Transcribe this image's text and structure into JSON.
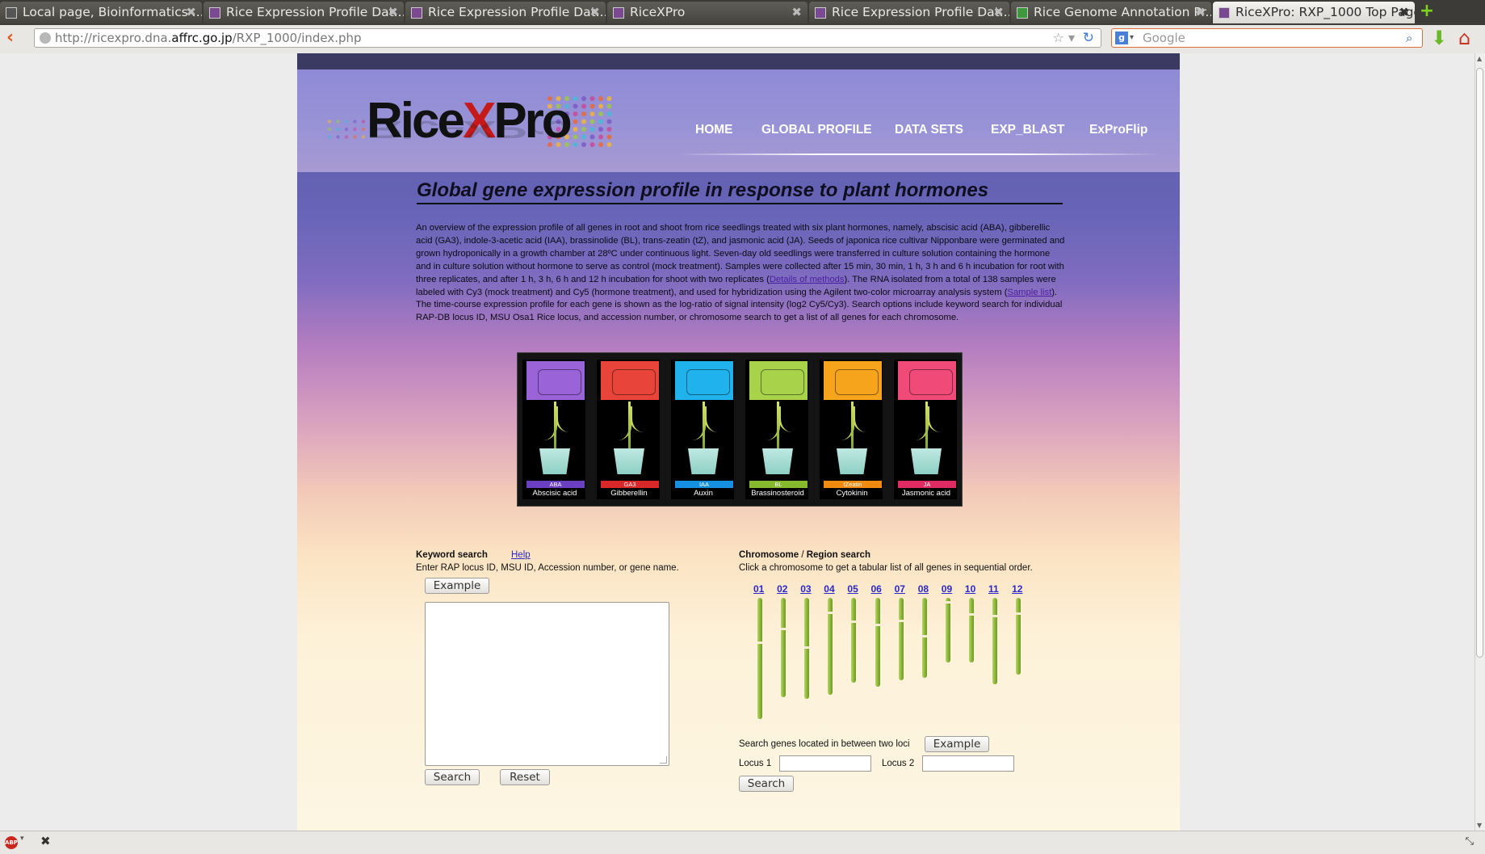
{
  "browser": {
    "tabs": [
      {
        "title": "Local page, Bioinformatics ...",
        "active": false
      },
      {
        "title": "Rice Expression Profile Dat...",
        "active": false
      },
      {
        "title": "Rice Expression Profile Dat...",
        "active": false
      },
      {
        "title": "RiceXPro",
        "active": false
      },
      {
        "title": "Rice Expression Profile Dat...",
        "active": false
      },
      {
        "title": "Rice Genome Annotation Pr...",
        "active": false
      },
      {
        "title": "RiceXPro: RXP_1000 Top Page",
        "active": true
      }
    ],
    "url_prefix": "http://ricexpro.dna.",
    "url_domain": "affrc.go.jp",
    "url_path": "/RXP_1000/index.php",
    "search_placeholder": "Google",
    "search_engine_icon": "g-icon",
    "close_glyph": "✖"
  },
  "site": {
    "logo_part1": "Rice",
    "logo_x": "X",
    "logo_part2": "Pro",
    "nav": [
      "HOME",
      "GLOBAL PROFILE",
      "DATA SETS",
      "EXP_BLAST",
      "ExProFlip"
    ],
    "colors": {
      "logo_accent": "#c61a1a",
      "link": "#2a28c8",
      "chromosome": "#8eb83a"
    }
  },
  "content": {
    "title": "Global gene expression profile in response to plant hormones",
    "intro_part1": "An overview of the expression profile of all genes in root and shoot from rice seedlings treated with six plant hormones, namely, abscisic acid (ABA), gibberellic acid (GA3), indole-3-acetic acid (IAA), brassinolide (BL), trans-zeatin (tZ), and jasmonic acid (JA). Seeds of japonica rice cultivar Nipponbare were germinated and grown hydroponically in a growth chamber at 28ºC under continuous light. Seven-day old seedlings were transferred in culture solution containing the hormone and in culture solution without hormone to serve as control (mock treatment). Samples were collected after 15 min, 30 min, 1 h, 3 h and 6 h incubation for root with three replicates, and after 1 h, 3 h, 6 h and 12 h incubation for shoot with two replicates (",
    "intro_link1": "Details of methods",
    "intro_part2": "). The RNA isolated from a total of 138 samples were labeled with Cy3 (mock treatment) and Cy5 (hormone treatment), and used for hybridization using the Agilent two-color microarray analysis system (",
    "intro_link2": "Sample list",
    "intro_part3": "). The time-course expression profile for each gene is shown as the log-ratio of signal intensity (log2 Cy5/Cy3). Search options include keyword search for individual RAP-DB locus ID, MSU Osa1 Rice locus, and accession number, or chromosome search to get a list of all genes for each chromosome."
  },
  "hormones": [
    {
      "abbr": "ABA",
      "name": "Abscisic acid",
      "color": "#9a63d8",
      "bar": "#6a3fc0"
    },
    {
      "abbr": "GA3",
      "name": "Gibberellin",
      "color": "#e8443a",
      "bar": "#d8282a"
    },
    {
      "abbr": "IAA",
      "name": "Auxin",
      "color": "#1fb2ec",
      "bar": "#1590e0"
    },
    {
      "abbr": "BL",
      "name": "Brassinosteroid",
      "color": "#a8d24a",
      "bar": "#86ba2c"
    },
    {
      "abbr": "tZeatin",
      "name": "Cytokinin",
      "color": "#f6a41c",
      "bar": "#f08a10"
    },
    {
      "abbr": "JA",
      "name": "Jasmonic acid",
      "color": "#f04a78",
      "bar": "#e02a62"
    }
  ],
  "keyword_search": {
    "heading": "Keyword search",
    "help_link": "Help",
    "description": "Enter RAP locus ID, MSU ID, Accession number, or gene name.",
    "example_button": "Example",
    "textarea_value": "",
    "search_button": "Search",
    "reset_button": "Reset"
  },
  "chromosome_search": {
    "heading_part1": "Chromosome",
    "heading_sep": " / ",
    "heading_part2": "Region search",
    "description": "Click a chromosome to get a tabular list of all genes in sequential order.",
    "chromosomes": [
      {
        "label": "01",
        "length": 1.0,
        "centromere": 0.36
      },
      {
        "label": "02",
        "length": 0.82,
        "centromere": 0.3
      },
      {
        "label": "03",
        "length": 0.83,
        "centromere": 0.48
      },
      {
        "label": "04",
        "length": 0.8,
        "centromere": 0.14
      },
      {
        "label": "05",
        "length": 0.7,
        "centromere": 0.27
      },
      {
        "label": "06",
        "length": 0.73,
        "centromere": 0.29
      },
      {
        "label": "07",
        "length": 0.68,
        "centromere": 0.26
      },
      {
        "label": "08",
        "length": 0.66,
        "centromere": 0.46
      },
      {
        "label": "09",
        "length": 0.53,
        "centromere": 0.05
      },
      {
        "label": "10",
        "length": 0.53,
        "centromere": 0.24
      },
      {
        "label": "11",
        "length": 0.71,
        "centromere": 0.2
      },
      {
        "label": "12",
        "length": 0.63,
        "centromere": 0.19
      }
    ],
    "between_loci_label": "Search genes located in between two loci",
    "example_button": "Example",
    "locus1_label": "Locus 1",
    "locus1_value": "",
    "locus2_label": "Locus 2",
    "locus2_value": "",
    "search_button": "Search"
  },
  "statusbar": {
    "abp_icon": "ABP",
    "close_glyph": "✖",
    "right_icon": "resize-icon"
  }
}
